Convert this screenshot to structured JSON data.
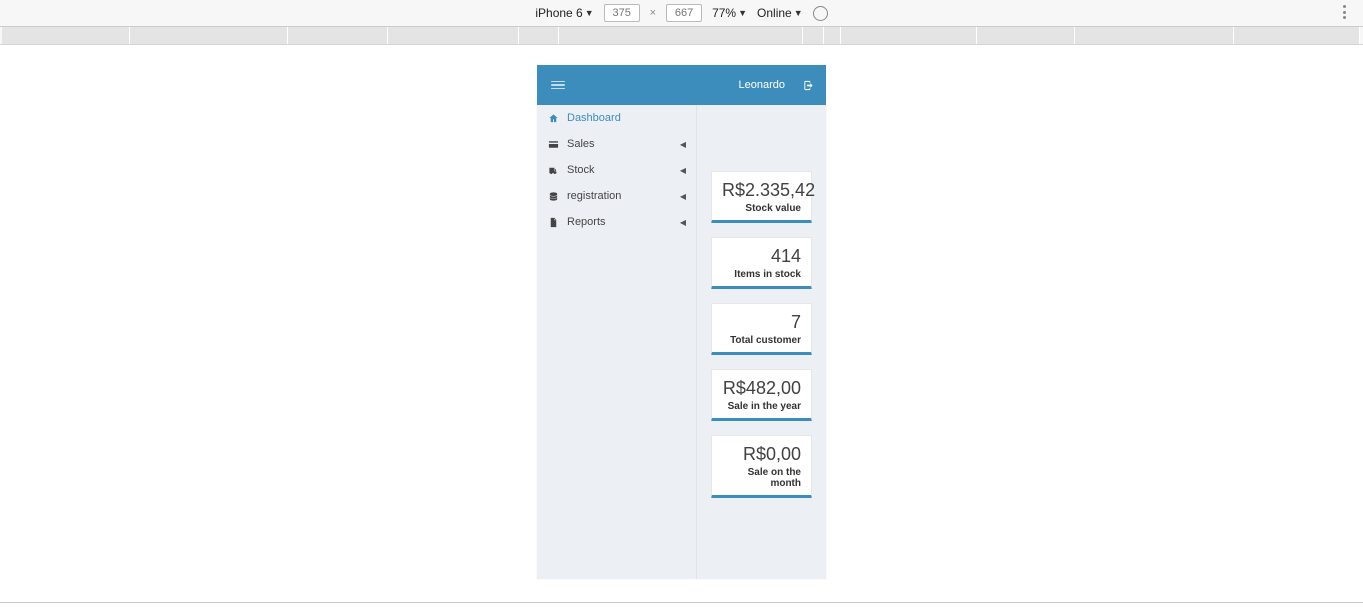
{
  "devtools": {
    "device": "iPhone 6",
    "width": "375",
    "height": "667",
    "zoom": "77%",
    "network": "Online"
  },
  "header": {
    "user": "Leonardo"
  },
  "sidebar": {
    "items": [
      {
        "label": "Dashboard"
      },
      {
        "label": "Sales"
      },
      {
        "label": "Stock"
      },
      {
        "label": "registration"
      },
      {
        "label": "Reports"
      }
    ]
  },
  "dashboard": {
    "cards": [
      {
        "value": "R$2.335,42",
        "label": "Stock value"
      },
      {
        "value": "414",
        "label": "Items in stock"
      },
      {
        "value": "7",
        "label": "Total customer"
      },
      {
        "value": "R$482,00",
        "label": "Sale in the year"
      },
      {
        "value": "R$0,00",
        "label": "Sale on the month"
      }
    ]
  }
}
